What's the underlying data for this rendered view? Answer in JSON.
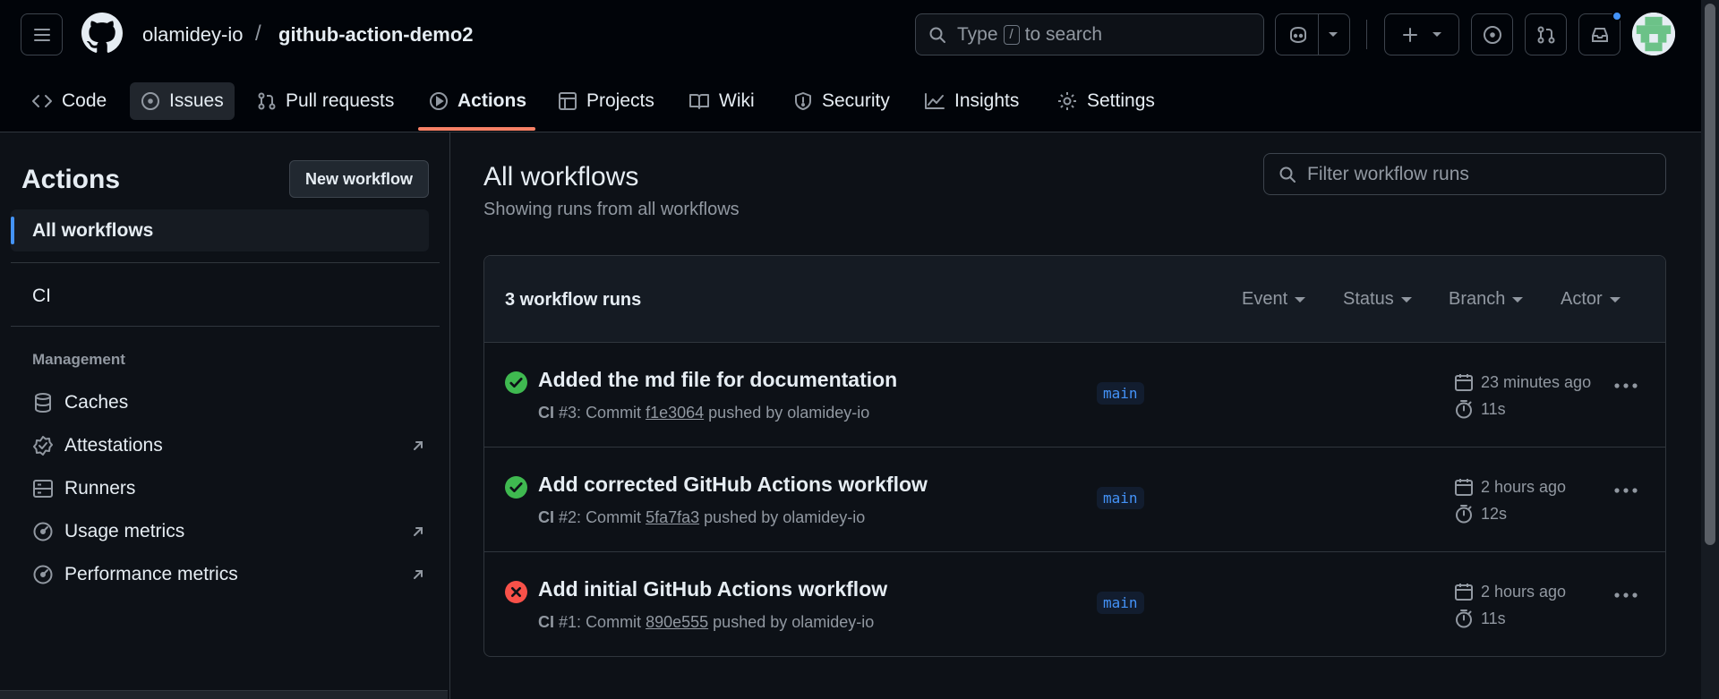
{
  "header": {
    "owner": "olamidey-io",
    "separator": "/",
    "repo": "github-action-demo2",
    "search_placeholder_prefix": "Type",
    "search_key": "/",
    "search_placeholder_suffix": "to search"
  },
  "tabs": [
    {
      "label": "Code",
      "icon": "code-icon"
    },
    {
      "label": "Issues",
      "icon": "issue-icon"
    },
    {
      "label": "Pull requests",
      "icon": "pull-request-icon"
    },
    {
      "label": "Actions",
      "icon": "actions-icon",
      "selected": true
    },
    {
      "label": "Projects",
      "icon": "project-icon"
    },
    {
      "label": "Wiki",
      "icon": "book-icon"
    },
    {
      "label": "Security",
      "icon": "shield-icon"
    },
    {
      "label": "Insights",
      "icon": "graph-icon"
    },
    {
      "label": "Settings",
      "icon": "gear-icon"
    }
  ],
  "sidebar": {
    "title": "Actions",
    "new_workflow": "New workflow",
    "all_workflows": "All workflows",
    "workflows": [
      "CI"
    ],
    "management_label": "Management",
    "management": [
      {
        "label": "Caches",
        "icon": "database-icon",
        "external": false
      },
      {
        "label": "Attestations",
        "icon": "verified-icon",
        "external": true
      },
      {
        "label": "Runners",
        "icon": "server-icon",
        "external": false
      },
      {
        "label": "Usage metrics",
        "icon": "meter-icon",
        "external": true
      },
      {
        "label": "Performance metrics",
        "icon": "meter-icon",
        "external": true
      }
    ]
  },
  "main": {
    "title": "All workflows",
    "subtitle": "Showing runs from all workflows",
    "filter_placeholder": "Filter workflow runs",
    "runs_count": "3 workflow runs",
    "filters": [
      "Event",
      "Status",
      "Branch",
      "Actor"
    ],
    "runs": [
      {
        "status": "success",
        "title": "Added the md file for documentation",
        "workflow": "CI",
        "number": "#3",
        "commit_label": "Commit",
        "sha": "f1e3064",
        "pushed_by": "pushed by olamidey-io",
        "branch": "main",
        "when": "23 minutes ago",
        "duration": "11s"
      },
      {
        "status": "success",
        "title": "Add corrected GitHub Actions workflow",
        "workflow": "CI",
        "number": "#2",
        "commit_label": "Commit",
        "sha": "5fa7fa3",
        "pushed_by": "pushed by olamidey-io",
        "branch": "main",
        "when": "2 hours ago",
        "duration": "12s"
      },
      {
        "status": "failure",
        "title": "Add initial GitHub Actions workflow",
        "workflow": "CI",
        "number": "#1",
        "commit_label": "Commit",
        "sha": "890e555",
        "pushed_by": "pushed by olamidey-io",
        "branch": "main",
        "when": "2 hours ago",
        "duration": "11s"
      }
    ]
  },
  "colors": {
    "success": "#3fb950",
    "failure": "#f85149",
    "accent": "#4493f8",
    "tab_underline": "#f78166",
    "notification_dot": "#4493f8"
  }
}
